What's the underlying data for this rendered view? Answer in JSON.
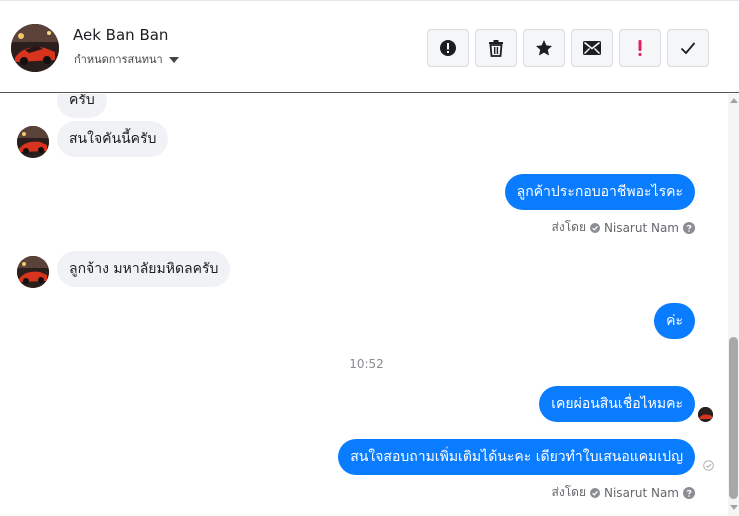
{
  "header": {
    "name": "Aek Ban Ban",
    "subtitle": "กำหนดการสนทนา",
    "avatar_icon": "contact-avatar-red-car",
    "toolbar": [
      {
        "icon": "alert-icon",
        "name": "mark-spam-button"
      },
      {
        "icon": "trash-icon",
        "name": "delete-button"
      },
      {
        "icon": "star-icon",
        "name": "star-button"
      },
      {
        "icon": "envelope-icon",
        "name": "mark-unread-button"
      },
      {
        "icon": "exclamation-icon",
        "name": "follow-up-button"
      },
      {
        "icon": "check-icon",
        "name": "mark-done-button"
      }
    ]
  },
  "messages": {
    "m0": "ครับ",
    "m1": "สนใจคันนี้ครับ",
    "m2": "ลูกค้าประกอบอาชีพอะไรคะ",
    "m3": "ลูกจ้าง มหาลัยมหิดลครับ",
    "m4": "ค่ะ",
    "timestamp": "10:52",
    "m5": "เคยผ่อนสินเชื่อไหมคะ",
    "m6": "สนใจสอบถามเพิ่มเติมได้นะคะ เดียวทำใบเสนอแคมเปญ",
    "sent_by_label": "ส่งโดย",
    "sent_by_name": "Nisarut Nam"
  },
  "colors": {
    "outgoing_bubble": "#0a7cff",
    "incoming_bubble": "#f0f2f5",
    "follow_up_icon": "#e0245e"
  }
}
